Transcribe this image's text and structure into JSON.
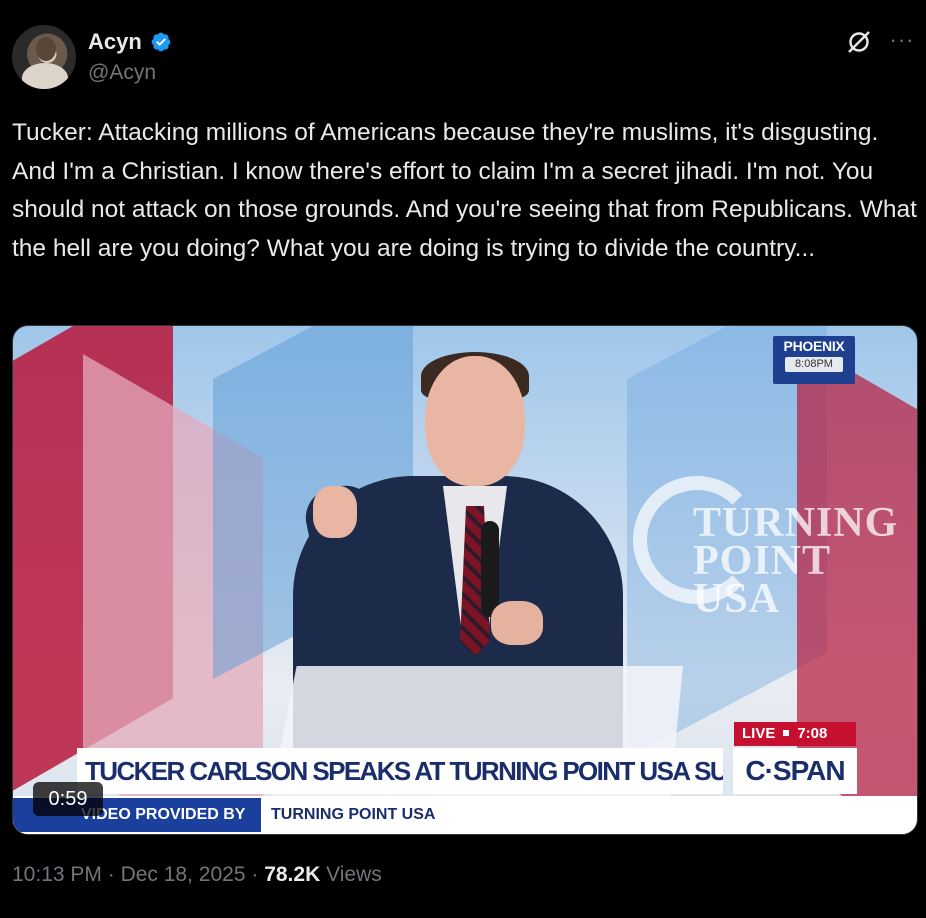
{
  "author": {
    "display_name": "Acyn",
    "handle": "@Acyn",
    "verified": true,
    "verified_color": "#1d9bf0"
  },
  "icons": {
    "grok": "grok-icon",
    "more": "more-icon"
  },
  "tweet": {
    "text": "Tucker: Attacking millions of Americans because they're muslims, it's disgusting. And I'm a Christian. I know there's effort to claim I'm a secret jihadi. I'm not. You should not attack on those grounds. And you're seeing that from Republicans. What the hell are you doing? What you are doing is trying to divide the country..."
  },
  "video": {
    "duration": "0:59",
    "location_bug": "PHOENIX",
    "location_time": "8:08PM",
    "live_label": "LIVE",
    "live_time": "7:08 PT",
    "headline": "TUCKER CARLSON SPEAKS AT TURNING POINT USA SUMMIT",
    "network": "C·SPAN",
    "provided_by_label": "VIDEO PROVIDED BY",
    "provided_by_value": "TURNING POINT USA",
    "backdrop_text": "TURNING POINT USA"
  },
  "meta": {
    "time": "10:13 PM",
    "separator": "·",
    "date": "Dec 18, 2025",
    "views_count": "78.2K",
    "views_label": "Views"
  }
}
